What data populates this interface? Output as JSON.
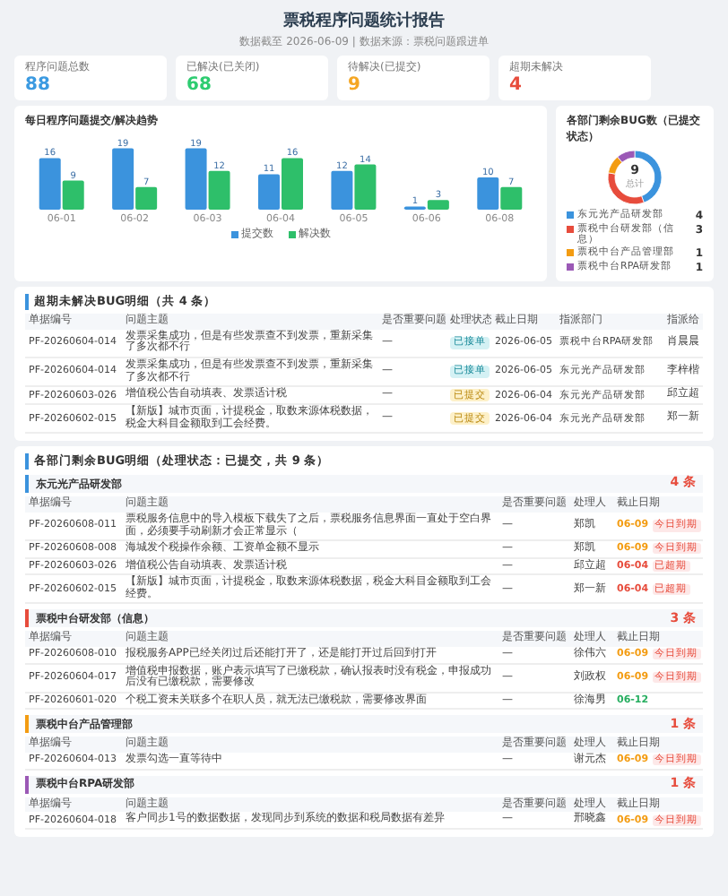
{
  "header": {
    "title": "票税程序问题统计报告",
    "subtitle": "数据截至 2026-06-09 | 数据来源：票税问题跟进单"
  },
  "stats": [
    {
      "label": "程序问题总数",
      "value": "88",
      "color": "#3b9ae1"
    },
    {
      "label": "已解决(已关闭)",
      "value": "68",
      "color": "#2ecc71"
    },
    {
      "label": "待解决(已提交)",
      "value": "9",
      "color": "#f5a623"
    },
    {
      "label": "超期未解决",
      "value": "4",
      "color": "#e74c3c"
    }
  ],
  "trend": {
    "title": "每日程序问题提交/解决趋势",
    "chart_data": {
      "type": "bar",
      "categories": [
        "06-01",
        "06-02",
        "06-03",
        "06-04",
        "06-05",
        "06-06",
        "06-08"
      ],
      "data_labels": true,
      "series": [
        {
          "name": "提交数",
          "color": "#3b93dd",
          "values": [
            16,
            19,
            19,
            11,
            12,
            1,
            10
          ]
        },
        {
          "name": "解决数",
          "color": "#2ebf6a",
          "values": [
            9,
            7,
            12,
            16,
            14,
            3,
            7
          ]
        }
      ]
    }
  },
  "departments": {
    "title": "各部门剩余BUG数（已提交状态）",
    "center_value": "9",
    "center_label": "总计",
    "items": [
      {
        "name": "东元光产品研发部",
        "count": "4",
        "color": "#3b93dd"
      },
      {
        "name": "票税中台研发部（信息）",
        "count": "3",
        "color": "#e74c3c"
      },
      {
        "name": "票税中台产品管理部",
        "count": "1",
        "color": "#f39c12"
      },
      {
        "name": "票税中台RPA研发部",
        "count": "1",
        "color": "#9b59b6"
      }
    ]
  },
  "overdue": {
    "title": "超期未解决BUG明细（共 4 条）",
    "columns": [
      "单据编号",
      "问题主题",
      "是否重要问题",
      "处理状态",
      "截止日期",
      "指派部门",
      "指派给"
    ],
    "rows": [
      {
        "id": "PF-20260604-014",
        "subject": "发票采集成功，但是有些发票查不到发票，重新采集了多次都不行",
        "important": "—",
        "status": "已接单",
        "accepted": true,
        "due": "2026-06-05",
        "dept": "票税中台RPA研发部",
        "assignee": "肖晨晨"
      },
      {
        "id": "PF-20260604-014",
        "subject": "发票采集成功，但是有些发票查不到发票，重新采集了多次都不行",
        "important": "—",
        "status": "已接单",
        "accepted": true,
        "due": "2026-06-05",
        "dept": "东元光产品研发部",
        "assignee": "李梓楷"
      },
      {
        "id": "PF-20260603-026",
        "subject": "增值税公告自动填表、发票适计税",
        "important": "—",
        "status": "已提交",
        "accepted": false,
        "due": "2026-06-04",
        "dept": "东元光产品研发部",
        "assignee": "邱立超"
      },
      {
        "id": "PF-20260602-015",
        "subject": "【新版】城市页面，计提税金，取数来源体税数据，税金大科目金额取到工会经费。",
        "important": "—",
        "status": "已提交",
        "accepted": false,
        "due": "2026-06-04",
        "dept": "东元光产品研发部",
        "assignee": "郑一新"
      }
    ]
  },
  "remaining": {
    "title": "各部门剩余BUG明细（处理状态：已提交，共 9 条）",
    "groups": [
      {
        "name": "东元光产品研发部",
        "count": "4 条",
        "color": "#3b93dd",
        "columns": [
          "单据编号",
          "问题主题",
          "是否重要问题",
          "处理人",
          "截止日期"
        ],
        "rows": [
          {
            "id": "PF-20260608-011",
            "subject": "票税服务信息中的导入模板下载失了之后，票税服务信息界面一直处于空白界面，必须要手动刷新才会正常显示（",
            "important": "—",
            "handler": "郑凯",
            "due": "06-09",
            "color": "#f39c12",
            "badge": "今日到期"
          },
          {
            "id": "PF-20260608-008",
            "subject": "海城发个税操作余额、工资单金额不显示",
            "important": "—",
            "handler": "郑凯",
            "due": "06-09",
            "color": "#f39c12",
            "badge": "今日到期"
          },
          {
            "id": "PF-20260603-026",
            "subject": "增值税公告自动填表、发票适计税",
            "important": "—",
            "handler": "邱立超",
            "due": "06-04",
            "color": "#e74c3c",
            "badge": "已超期"
          },
          {
            "id": "PF-20260602-015",
            "subject": "【新版】城市页面，计提税金，取数来源体税数据，税金大科目金额取到工会经费。",
            "important": "—",
            "handler": "郑一新",
            "due": "06-04",
            "color": "#e74c3c",
            "badge": "已超期"
          }
        ]
      },
      {
        "name": "票税中台研发部（信息）",
        "count": "3 条",
        "color": "#e74c3c",
        "columns": [
          "单据编号",
          "问题主题",
          "是否重要问题",
          "处理人",
          "截止日期"
        ],
        "rows": [
          {
            "id": "PF-20260608-010",
            "subject": "报税服务APP已经关闭过后还能打开了，还是能打开过后回到打开",
            "important": "—",
            "handler": "徐伟六",
            "due": "06-09",
            "color": "#f39c12",
            "badge": "今日到期"
          },
          {
            "id": "PF-20260604-017",
            "subject": "增值税申报数据，账户表示填写了已缴税款，确认报表时没有税金，申报成功后没有已缴税款，需要修改",
            "important": "—",
            "handler": "刘政权",
            "due": "06-09",
            "color": "#f39c12",
            "badge": "今日到期"
          },
          {
            "id": "PF-20260601-020",
            "subject": "个税工资未关联多个在职人员，就无法已缴税款，需要修改界面",
            "important": "—",
            "handler": "徐海男",
            "due": "06-12",
            "color": "#27ae60"
          }
        ]
      },
      {
        "name": "票税中台产品管理部",
        "count": "1 条",
        "color": "#f39c12",
        "columns": [
          "单据编号",
          "问题主题",
          "是否重要问题",
          "处理人",
          "截止日期"
        ],
        "rows": [
          {
            "id": "PF-20260604-013",
            "subject": "发票勾选一直等待中",
            "important": "—",
            "handler": "谢元杰",
            "due": "06-09",
            "color": "#f39c12",
            "badge": "今日到期"
          }
        ]
      },
      {
        "name": "票税中台RPA研发部",
        "count": "1 条",
        "color": "#9b59b6",
        "columns": [
          "单据编号",
          "问题主题",
          "是否重要问题",
          "处理人",
          "截止日期"
        ],
        "rows": [
          {
            "id": "PF-20260604-018",
            "subject": "客户同步1号的数据数据，发现同步到系统的数据和税局数据有差异",
            "important": "—",
            "handler": "邢晓鑫",
            "due": "06-09",
            "color": "#f39c12",
            "badge": "今日到期"
          }
        ]
      }
    ]
  }
}
